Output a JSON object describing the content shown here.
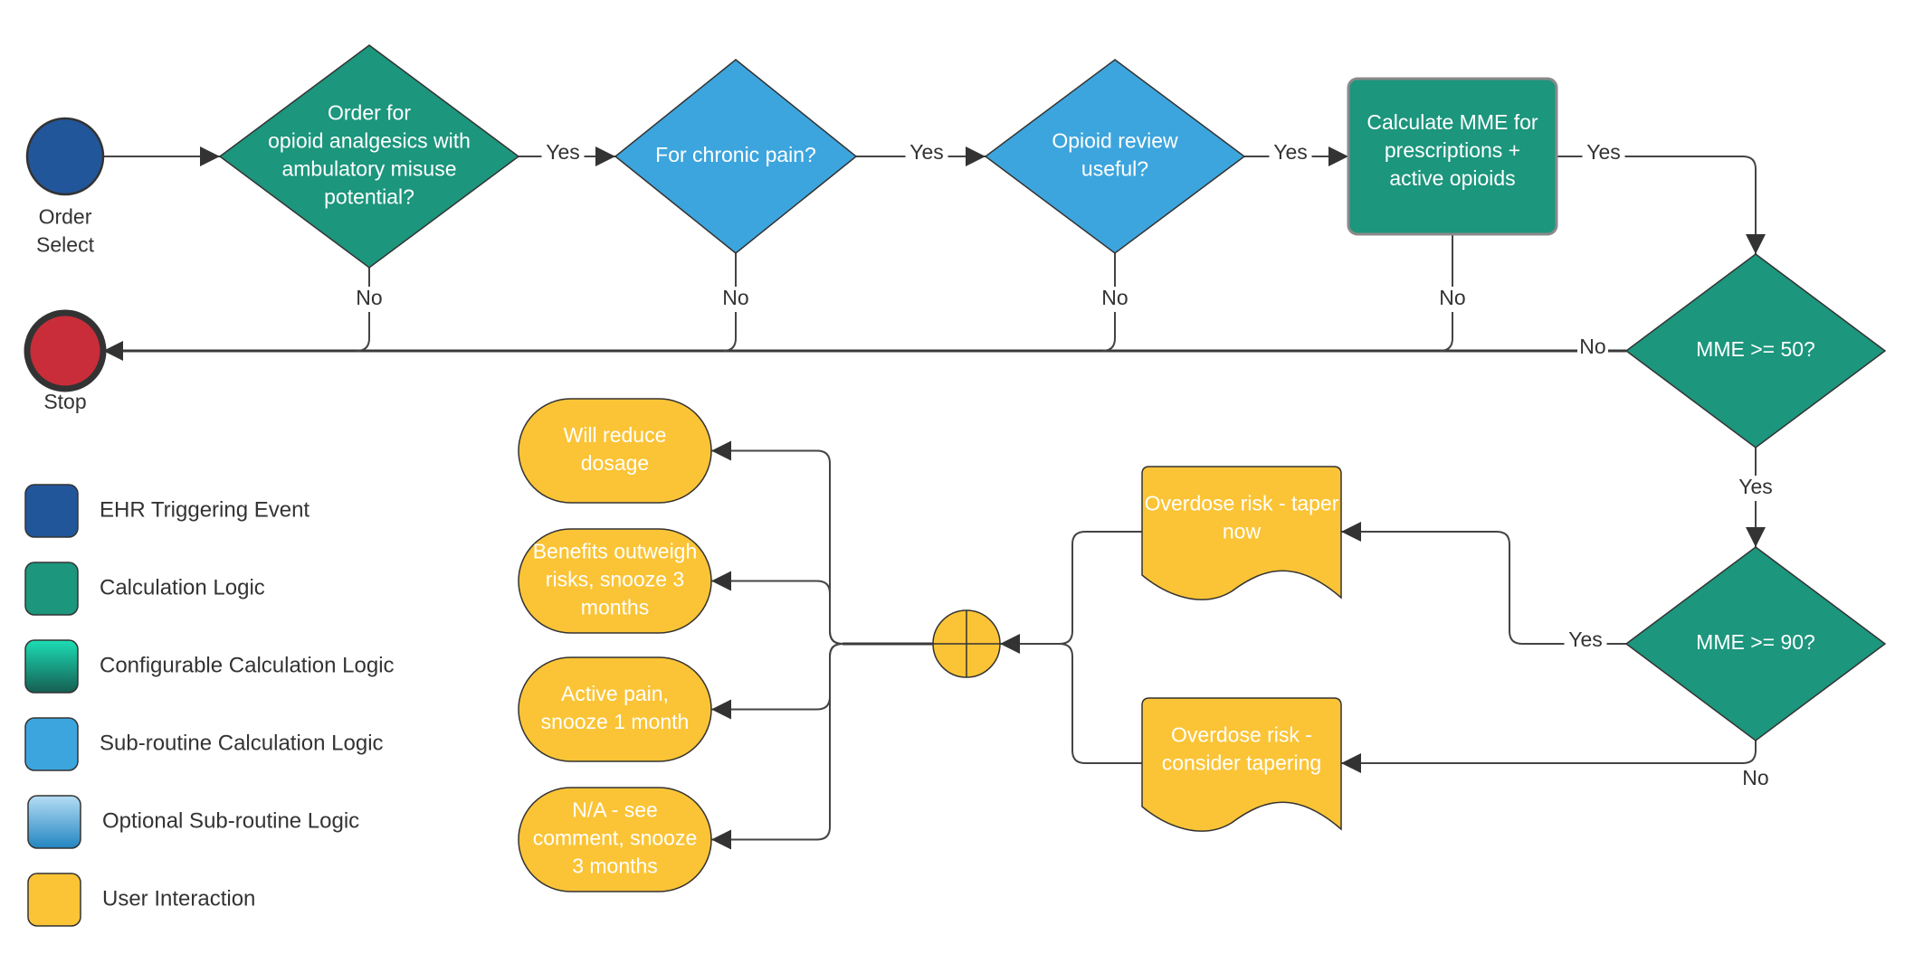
{
  "colors": {
    "ehr": "#22569A",
    "calc": "#1C967D",
    "config_top": "#1CDDB5",
    "config_bottom": "#155E52",
    "sub": "#3DA5DD",
    "opt_top": "#B5DDF5",
    "opt_bottom": "#2285C0",
    "user": "#FBC436",
    "stop": "#C92D39",
    "line": "#444444"
  },
  "nodes": {
    "start": {
      "caption": [
        "Order",
        "Select"
      ]
    },
    "stop": {
      "caption": [
        "Stop"
      ]
    },
    "order_check": {
      "lines": [
        "Order for",
        "opioid analgesics with",
        "ambulatory misuse",
        "potential?"
      ]
    },
    "chronic_pain": {
      "lines": [
        "For chronic pain?"
      ]
    },
    "review_useful": {
      "lines": [
        "Opioid review",
        "useful?"
      ]
    },
    "calc_mme": {
      "lines": [
        "Calculate MME for",
        "prescriptions +",
        "active opioids"
      ]
    },
    "mme50": {
      "lines": [
        "MME >= 50?"
      ]
    },
    "mme90": {
      "lines": [
        "MME >= 90?"
      ]
    },
    "taper_now": {
      "lines": [
        "Overdose risk - taper",
        "now"
      ]
    },
    "consider_taper": {
      "lines": [
        "Overdose risk -",
        "consider tapering"
      ]
    },
    "reduce": {
      "lines": [
        "Will reduce",
        "dosage"
      ]
    },
    "benefits": {
      "lines": [
        "Benefits outweigh",
        "risks, snooze 3",
        "months"
      ]
    },
    "active_pain": {
      "lines": [
        "Active pain,",
        "snooze 1 month"
      ]
    },
    "na": {
      "lines": [
        "N/A - see",
        "comment, snooze",
        "3 months"
      ]
    }
  },
  "edge_labels": {
    "yes": "Yes",
    "no": "No"
  },
  "legend": [
    {
      "key": "ehr",
      "label": "EHR Triggering Event"
    },
    {
      "key": "calc",
      "label": "Calculation Logic"
    },
    {
      "key": "config",
      "label": "Configurable Calculation Logic"
    },
    {
      "key": "sub",
      "label": "Sub-routine Calculation Logic"
    },
    {
      "key": "opt",
      "label": "Optional Sub-routine Logic"
    },
    {
      "key": "user",
      "label": "User Interaction"
    }
  ]
}
